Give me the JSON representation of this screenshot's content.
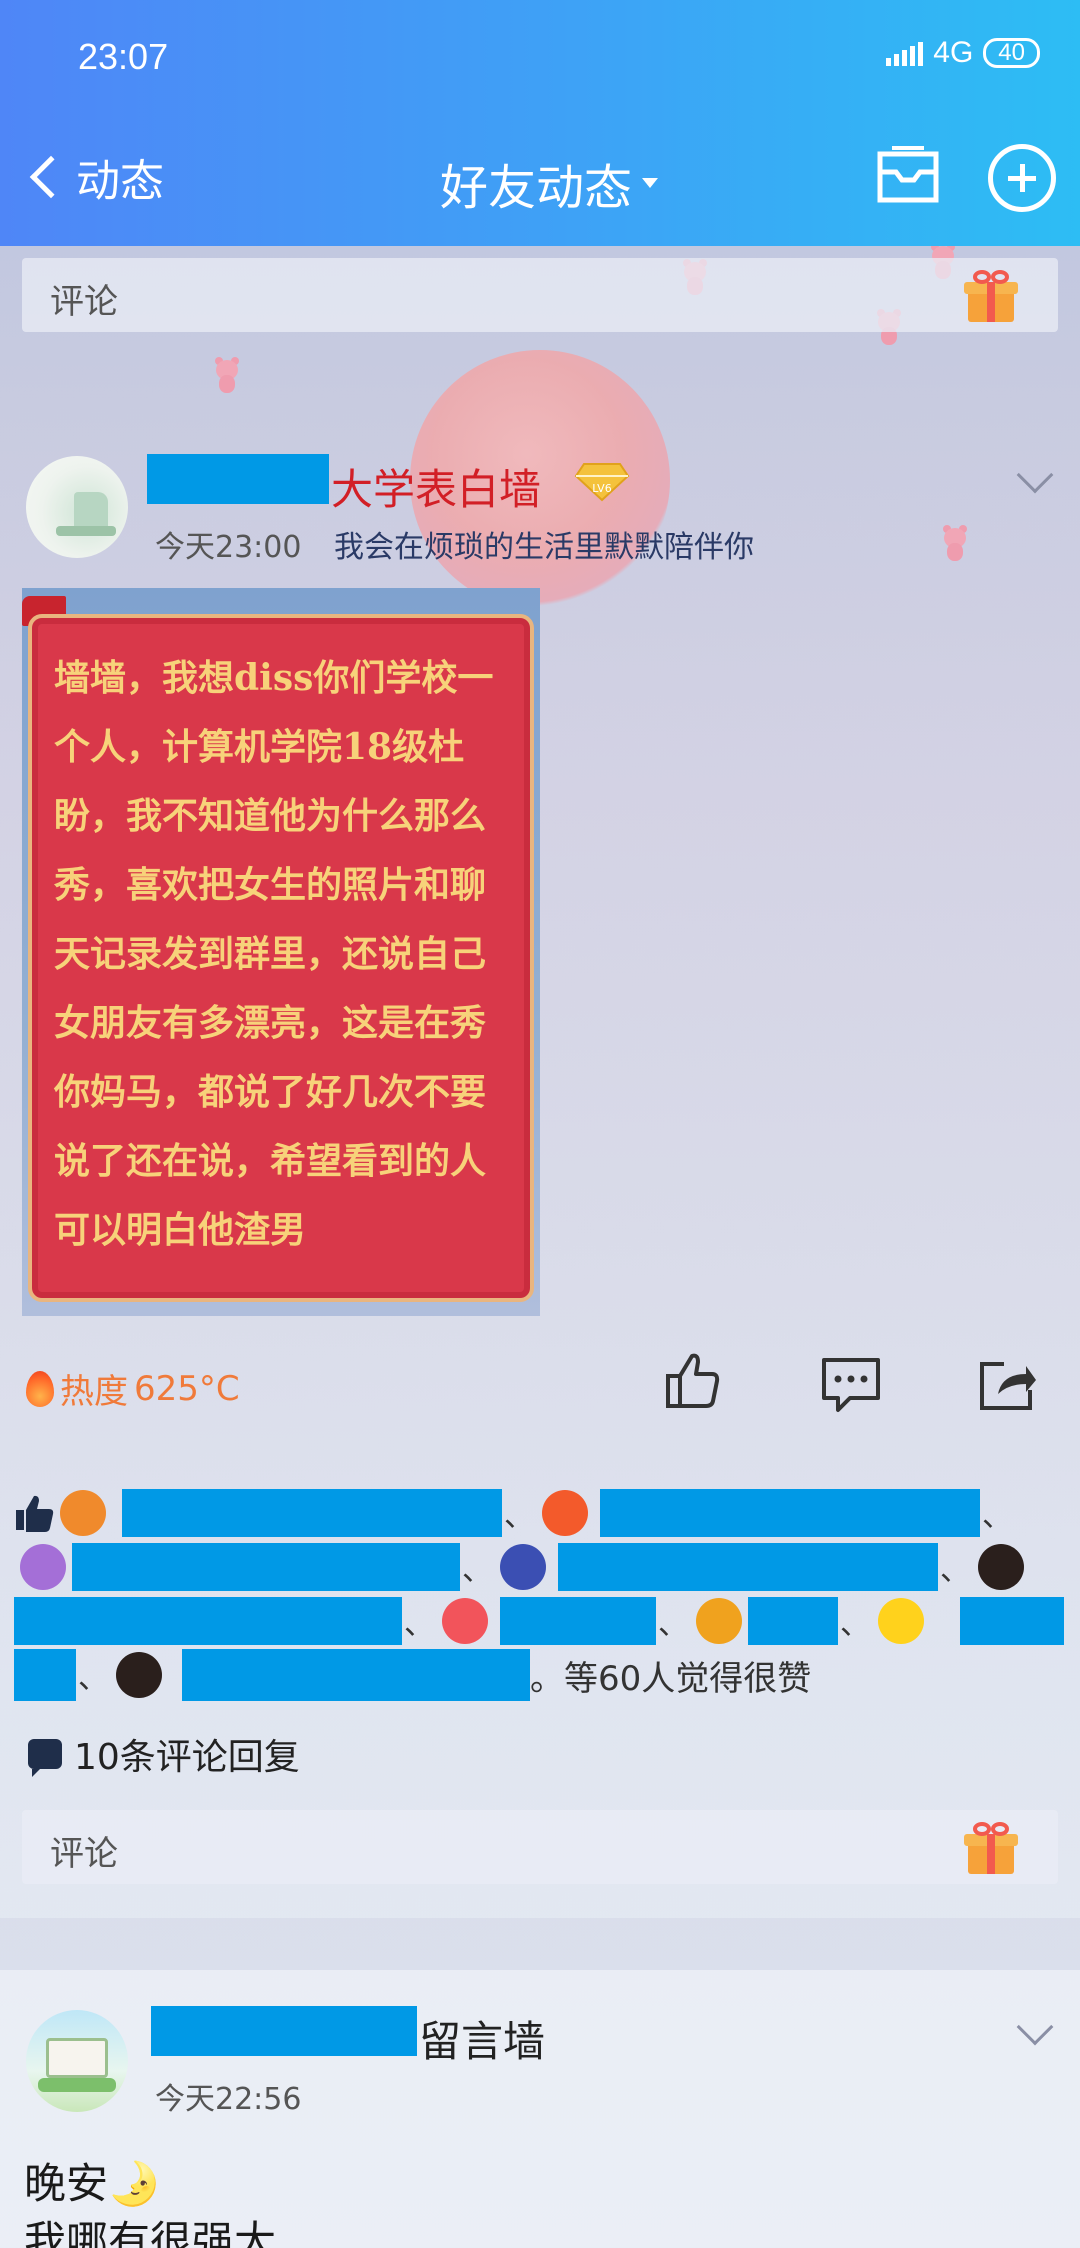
{
  "status": {
    "time": "23:07",
    "network": "4G",
    "battery": "40"
  },
  "header": {
    "back_label": "动态",
    "title": "好友动态"
  },
  "comment_placeholder": "评论",
  "post1": {
    "author_suffix": "大学表白墙",
    "level": "LV6",
    "time": "今天23:00",
    "tagline": "我会在烦琐的生活里默默陪伴你",
    "image_text": "墙墙，我想diss你们学校一个人，计算机学院18级杜盼，我不知道他为什么那么秀，喜欢把女生的照片和聊天记录发到群里，还说自己女朋友有多漂亮，这是在秀你妈马，都说了好几次不要说了还在说，希望看到的人可以明白他渣男",
    "heat_label": "热度",
    "heat_value": "625°C",
    "likes_summary": "。等60人觉得很赞",
    "separator": "、",
    "comment_count": "10条评论回复"
  },
  "post2": {
    "author_suffix": "留言墙",
    "time": "今天22:56",
    "line1": "晚安🌛",
    "line2": "我哪有很强大"
  },
  "colors": {
    "header_from": "#4f86f7",
    "header_to": "#2dbdf4",
    "redaction": "#0099e6",
    "author_name": "#d21f26",
    "heat": "#f07a3a"
  }
}
